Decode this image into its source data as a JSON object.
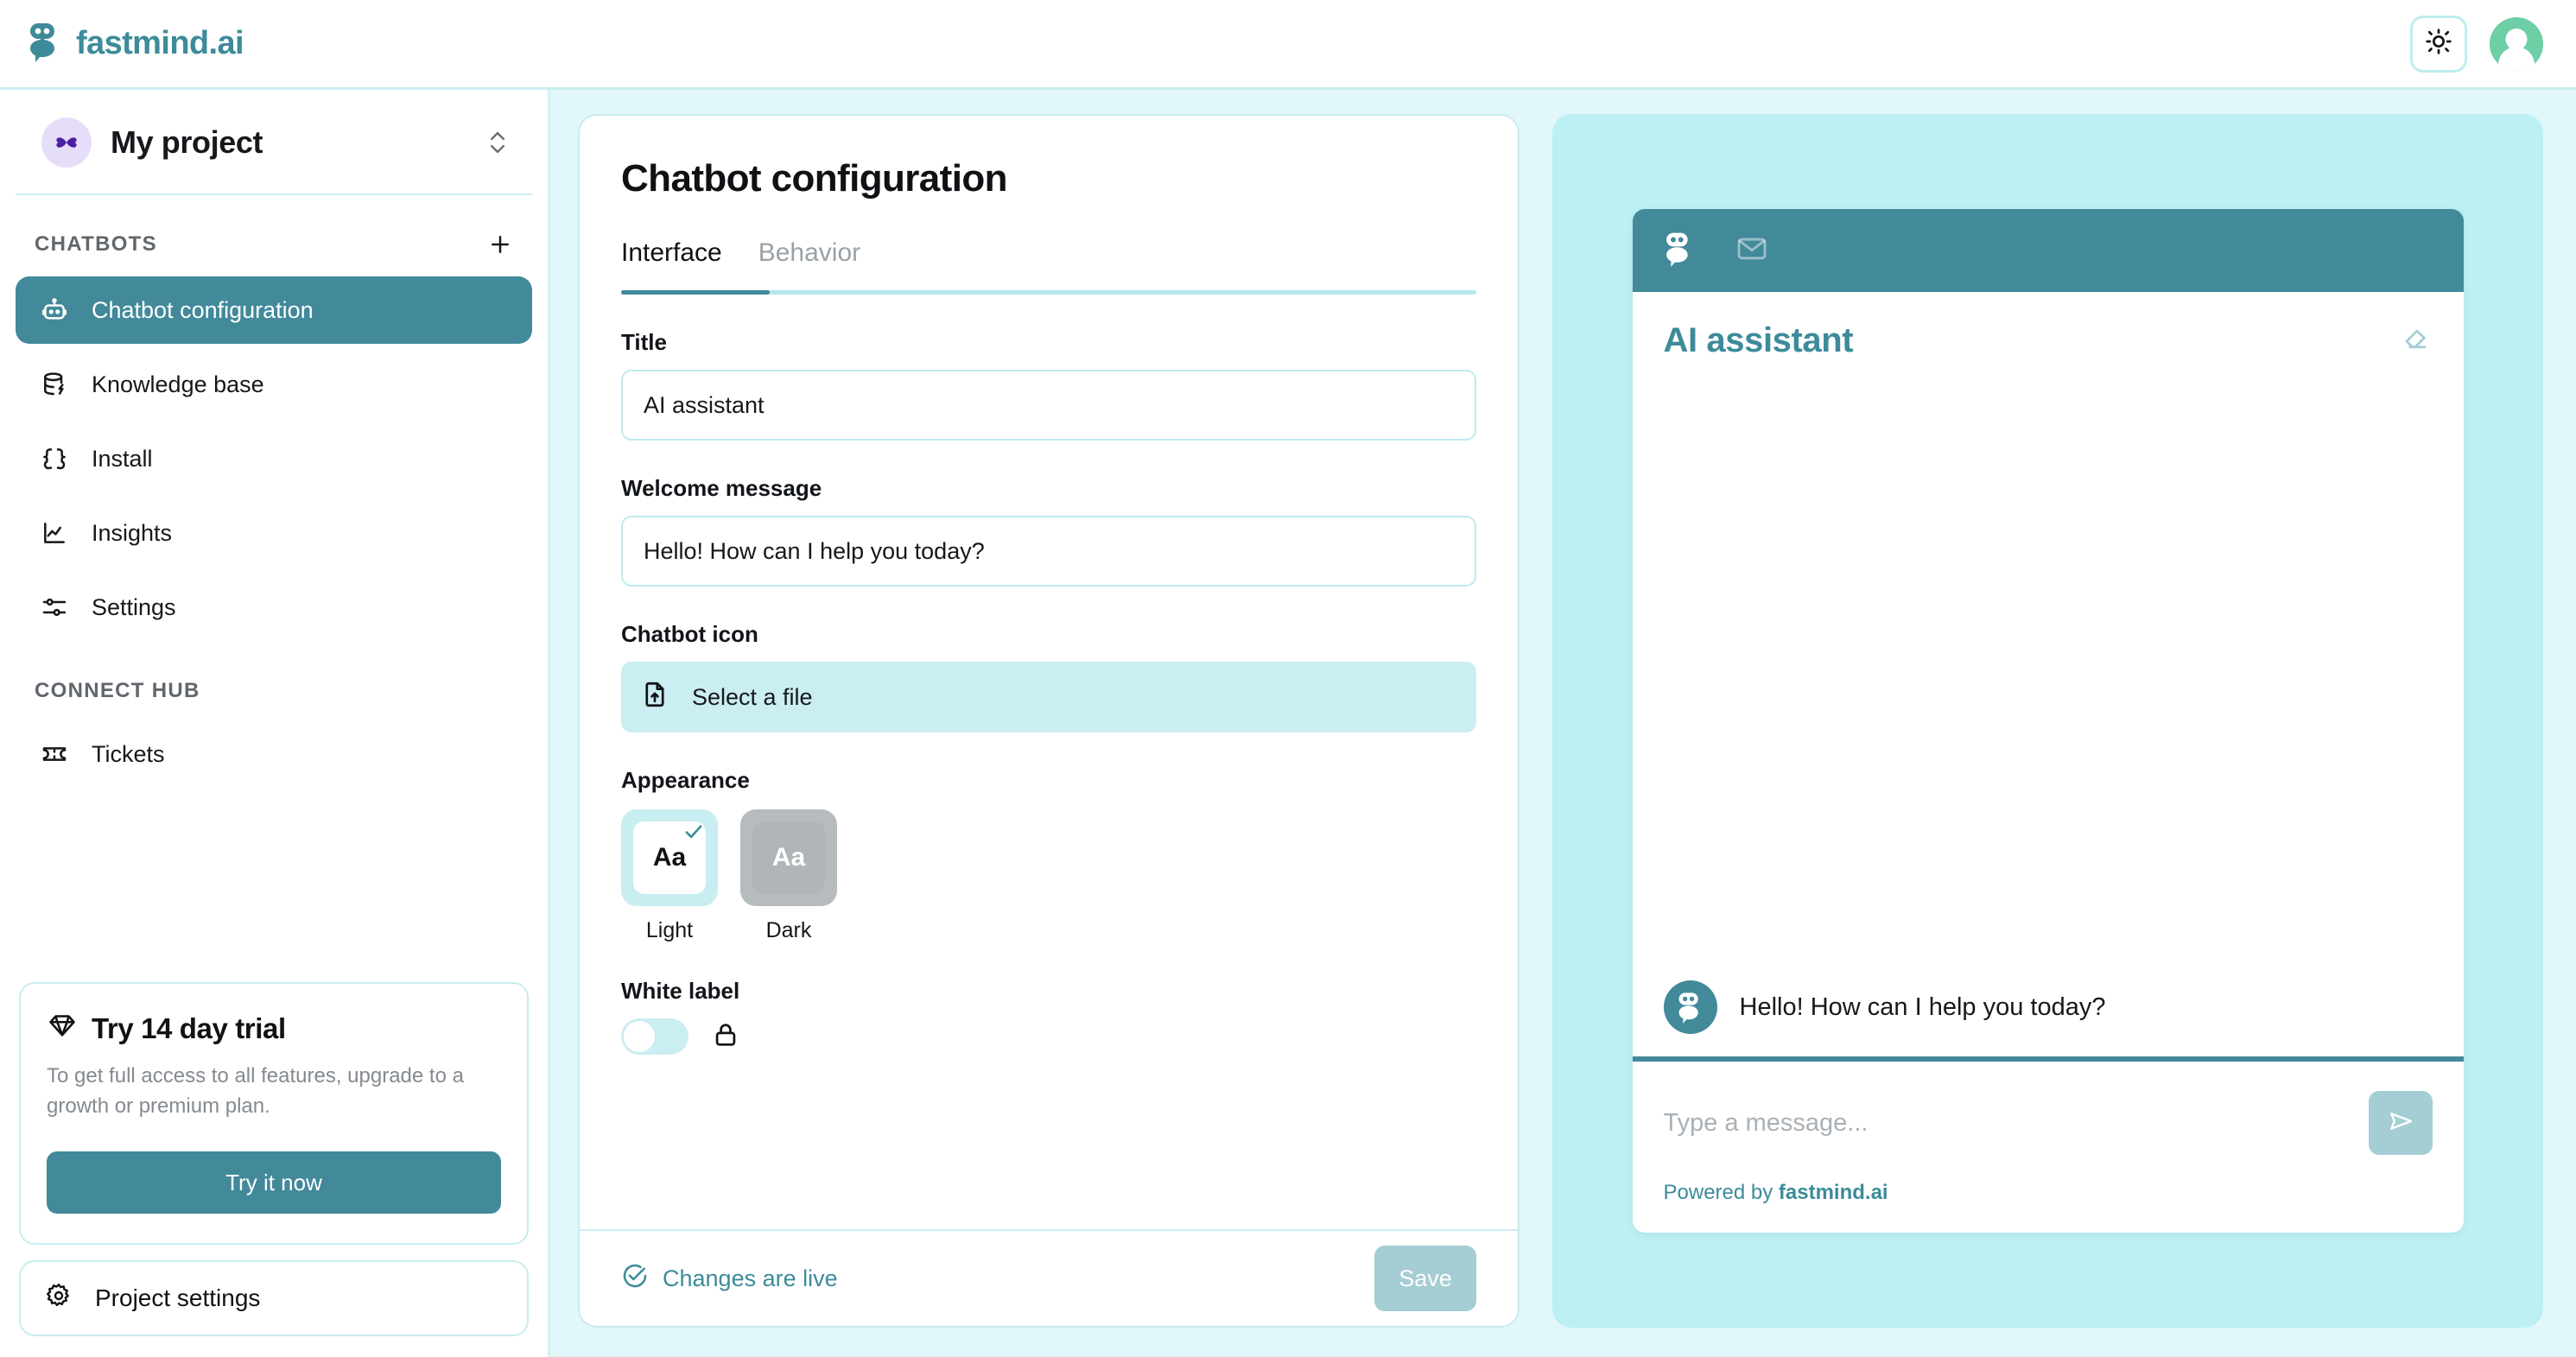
{
  "topbar": {
    "brand_name": "fastmind.ai",
    "theme_toggle_icon": "sun-icon",
    "avatar_icon": "user-avatar"
  },
  "sidebar": {
    "project": {
      "name": "My project",
      "switcher_icon": "chevron-up-down-icon"
    },
    "sections": [
      {
        "label": "CHATBOTS",
        "add_icon": "plus-icon"
      },
      {
        "label": "CONNECT HUB"
      }
    ],
    "chatbot_items": [
      {
        "label": "Chatbot configuration",
        "icon": "robot-icon",
        "active": true
      },
      {
        "label": "Knowledge base",
        "icon": "database-bolt-icon",
        "active": false
      },
      {
        "label": "Install",
        "icon": "curly-braces-icon",
        "active": false
      },
      {
        "label": "Insights",
        "icon": "line-chart-icon",
        "active": false
      },
      {
        "label": "Settings",
        "icon": "sliders-icon",
        "active": false
      }
    ],
    "hub_items": [
      {
        "label": "Tickets",
        "icon": "ticket-icon",
        "active": false
      }
    ],
    "trial": {
      "title": "Try 14 day trial",
      "icon": "diamond-icon",
      "description": "To get full access to all features, upgrade to a growth or premium plan.",
      "button_label": "Try it now"
    },
    "project_settings": {
      "label": "Project settings",
      "icon": "gear-icon"
    }
  },
  "config": {
    "page_title": "Chatbot configuration",
    "tabs": [
      {
        "label": "Interface",
        "active": true
      },
      {
        "label": "Behavior",
        "active": false
      }
    ],
    "fields": {
      "title_label": "Title",
      "title_value": "AI assistant",
      "welcome_label": "Welcome message",
      "welcome_value": "Hello! How can I help you today?",
      "icon_label": "Chatbot icon",
      "file_button_label": "Select a file",
      "file_icon": "file-upload-icon",
      "appearance_label": "Appearance",
      "appearance_options": [
        {
          "caption": "Light",
          "sample": "Aa",
          "selected": true
        },
        {
          "caption": "Dark",
          "sample": "Aa",
          "selected": false
        }
      ],
      "white_label_label": "White label",
      "white_label_enabled": false,
      "white_label_lock_icon": "lock-icon"
    },
    "footer": {
      "status_text": "Changes are live",
      "status_icon": "check-circle-icon",
      "save_label": "Save"
    }
  },
  "preview": {
    "tabs": [
      {
        "icon": "robot-icon",
        "active": true
      },
      {
        "icon": "envelope-icon",
        "active": false
      }
    ],
    "title": "AI assistant",
    "clear_icon": "eraser-icon",
    "messages": [
      {
        "sender": "bot",
        "text": "Hello! How can I help you today?",
        "avatar_icon": "robot-icon"
      }
    ],
    "input_placeholder": "Type a message...",
    "send_icon": "send-icon",
    "powered_prefix": "Powered by ",
    "powered_brand": "fastmind.ai"
  },
  "colors": {
    "primary_teal": "#42899a",
    "brand_teal": "#3d8b9a",
    "light_cyan": "#bcf0f3",
    "pale_cyan": "#e1f7f9",
    "border_cyan": "#c8ecef",
    "muted_teal": "#a5cdd4",
    "avatar_green": "#6ccfa5",
    "project_purple": "#4b1fa8"
  }
}
